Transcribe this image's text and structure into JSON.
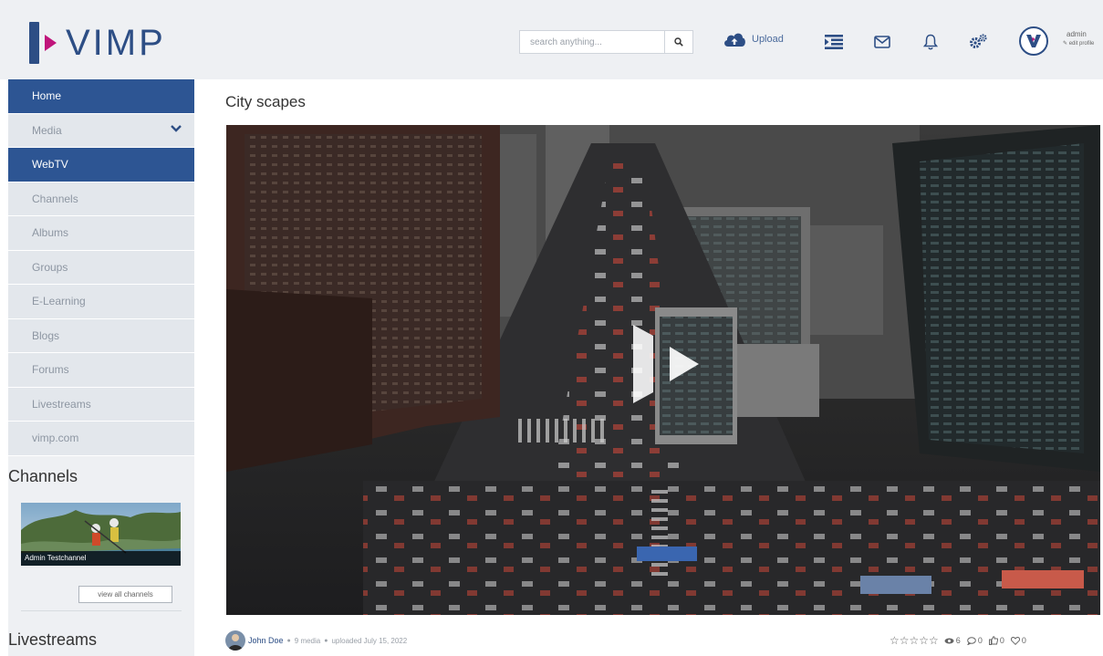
{
  "header": {
    "logo_text": "VIMP",
    "search_placeholder": "search anything...",
    "upload_label": "Upload",
    "user_name": "admin",
    "edit_profile": "edit profile"
  },
  "sidebar": {
    "items": [
      {
        "label": "Home"
      },
      {
        "label": "Media"
      },
      {
        "label": "WebTV"
      },
      {
        "label": "Channels"
      },
      {
        "label": "Albums"
      },
      {
        "label": "Groups"
      },
      {
        "label": "E-Learning"
      },
      {
        "label": "Blogs"
      },
      {
        "label": "Forums"
      },
      {
        "label": "Livestreams"
      },
      {
        "label": "vimp.com"
      }
    ],
    "channels_heading": "Channels",
    "channel_name": "Admin Testchannel",
    "view_all_label": "view all channels",
    "livestreams_heading": "Livestreams"
  },
  "main": {
    "title": "City scapes",
    "author": "John Doe",
    "media_count": "9 media",
    "uploaded": "uploaded July 15, 2022",
    "rating_stars": "☆☆☆☆☆",
    "views": "6",
    "comments": "0",
    "likes": "0",
    "favorites": "0"
  },
  "colors": {
    "brand_blue": "#2d4e85",
    "brand_magenta": "#c0157b",
    "active_nav": "#2d5593",
    "header_bg": "#eef0f3"
  }
}
